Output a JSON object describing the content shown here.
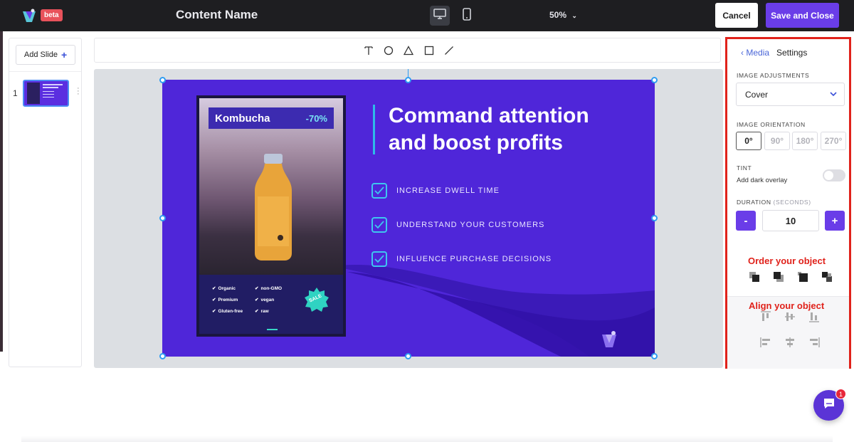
{
  "header": {
    "beta_badge": "beta",
    "content_name": "Content Name",
    "zoom": "50%",
    "cancel_label": "Cancel",
    "save_label": "Save and Close"
  },
  "slides_panel": {
    "add_slide_label": "Add Slide",
    "add_slide_icon": "+",
    "slides": [
      {
        "number": "1"
      }
    ]
  },
  "tools": [
    "text-tool",
    "circle-tool",
    "triangle-tool",
    "square-tool",
    "line-tool"
  ],
  "slide": {
    "background_color": "#4f26d9",
    "card": {
      "product": "Kombucha",
      "discount": "-70%",
      "features": [
        "Organic",
        "non-GMO",
        "Premium",
        "vegan",
        "Gluten-free",
        "raw"
      ],
      "sale_badge": "SALE"
    },
    "headline_line1": "Command attention",
    "headline_line2": "and boost profits",
    "checklist": [
      "INCREASE DWELL TIME",
      "UNDERSTAND YOUR CUSTOMERS",
      "INFLUENCE PURCHASE DECISIONS"
    ]
  },
  "settings": {
    "back_label": "Media",
    "tab_label": "Settings",
    "image_adjustments_label": "IMAGE ADJUSTMENTS",
    "image_adjustment_value": "Cover",
    "image_orientation_label": "IMAGE ORIENTATION",
    "orientations": [
      "0°",
      "90°",
      "180°",
      "270°"
    ],
    "orientation_selected": "0°",
    "tint_label": "TINT",
    "tint_sub": "Add dark overlay",
    "tint_enabled": false,
    "duration_label": "DURATION",
    "duration_unit": "(SECONDS)",
    "duration_value": "10",
    "minus_label": "-",
    "plus_label": "+",
    "order_label": "Order your object",
    "align_label": "Align your object"
  },
  "chat": {
    "badge_count": "1"
  },
  "colors": {
    "accent": "#6a3de8",
    "highlight_border": "#e0221b",
    "selection": "#2e9cf2"
  }
}
